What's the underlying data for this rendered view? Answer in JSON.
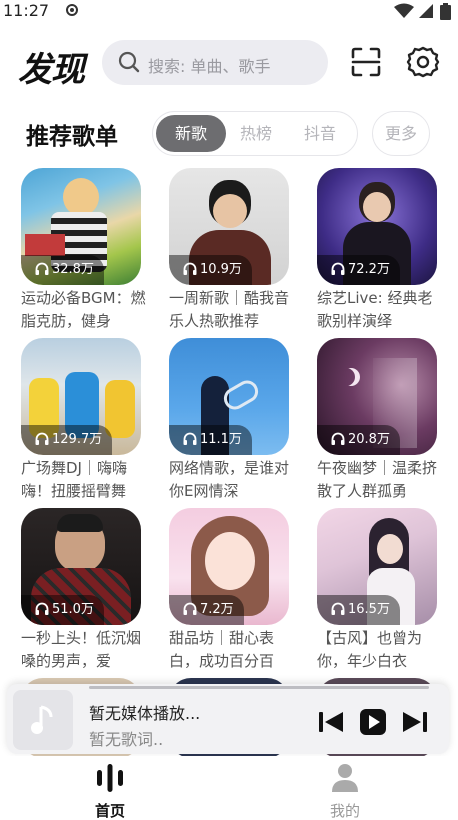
{
  "status_bar": {
    "time": "11:27"
  },
  "header": {
    "logo": "发现",
    "search_placeholder": "搜索: 单曲、歌手"
  },
  "section": {
    "title": "推荐歌单",
    "tabs": [
      {
        "label": "新歌",
        "active": true
      },
      {
        "label": "热榜",
        "active": false
      },
      {
        "label": "抖音",
        "active": false
      }
    ],
    "more_label": "更多"
  },
  "playlists": [
    {
      "count": "32.8万",
      "caption": "运动必备BGM：燃脂克肪，健身"
    },
    {
      "count": "10.9万",
      "caption": "一周新歌｜酷我音乐人热歌推荐"
    },
    {
      "count": "72.2万",
      "caption": "综艺Live: 经典老歌别样演绎"
    },
    {
      "count": "129.7万",
      "caption": "广场舞DJ｜嗨嗨嗨！扭腰摇臂舞"
    },
    {
      "count": "11.1万",
      "caption": "网络情歌，是谁对你E网情深"
    },
    {
      "count": "20.8万",
      "caption": "午夜幽梦｜温柔挤散了人群孤勇"
    },
    {
      "count": "51.0万",
      "caption": "一秒上头！低沉烟嗓的男声，爱"
    },
    {
      "count": "7.2万",
      "caption": "甜品坊｜甜心表白，成功百分百"
    },
    {
      "count": "16.5万",
      "caption": "【古风】也曾为你，年少白衣"
    }
  ],
  "player": {
    "title": "暂无媒体播放...",
    "subtitle": "暂无歌词.."
  },
  "bottom_nav": [
    {
      "label": "首页",
      "active": true
    },
    {
      "label": "我的",
      "active": false
    }
  ],
  "colors": {
    "active_tab_bg": "#6d6d70",
    "search_bg": "#ececf1",
    "player_bg": "#f2f2f4",
    "inactive_text": "#b5b5ba"
  }
}
